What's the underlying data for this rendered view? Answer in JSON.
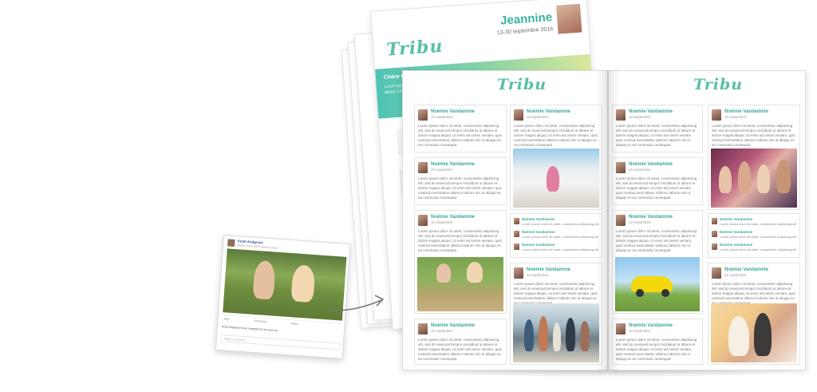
{
  "brand": {
    "logo_text": "Tribu",
    "accent": "#59bfa6"
  },
  "cover": {
    "name": "Jeannine",
    "date": "13-30 septembre 2016",
    "band_title": "Chère Grand...",
    "band_text": "Lorem ipsum dolor sit amet, consectetur magna aliqua. Ut enim ad minim de consequat."
  },
  "post_template": {
    "name": "Noémie Vandamme",
    "date": "10 septembre",
    "text": "Lorem ipsum dolor sit amet, consectetur adipiscing elit, sed do eiusmod tempor incididunt ut labore et dolore magna aliqua. Ut enim ad minim veniam, quis nostrud exercitation ullamco laboris nisi ut aliquip ex ea commodo consequat."
  },
  "mini_post": {
    "name": "Noémie Vandamme",
    "text": "Lorem ipsum dolor sit amet, consectetur adipiscing elit"
  },
  "social_post": {
    "author": "Anaé Andgrset",
    "meta": "Added TALE LIFE Videos | créés",
    "date": "11 mars",
    "actions": [
      "Like",
      "Comment",
      "Share"
    ],
    "comment": "Anaé Andgrset Anaé andgrset for the last one",
    "write_placeholder": "Write a comment..."
  }
}
